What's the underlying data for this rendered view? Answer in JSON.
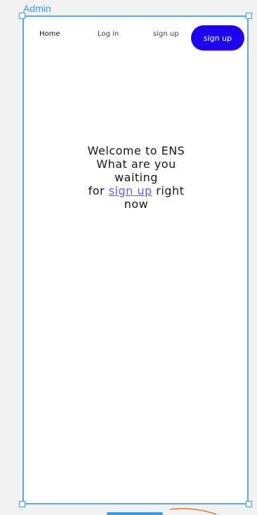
{
  "canvas": {
    "frame_label": "Admin"
  },
  "nav": {
    "home": "Home",
    "login": "Log in",
    "signup_link": "sign up",
    "signup_button": "sign up"
  },
  "hero": {
    "line1": "Welcome to ENS",
    "line2": "What are you",
    "line3": "waiting",
    "line4_prefix": "for ",
    "line4_link": "sign up",
    "line4_suffix": " right",
    "line5": "now"
  },
  "colors": {
    "primary_button": "#1d00f0",
    "link": "#6a5cf0",
    "selection": "#3b9ae8"
  }
}
